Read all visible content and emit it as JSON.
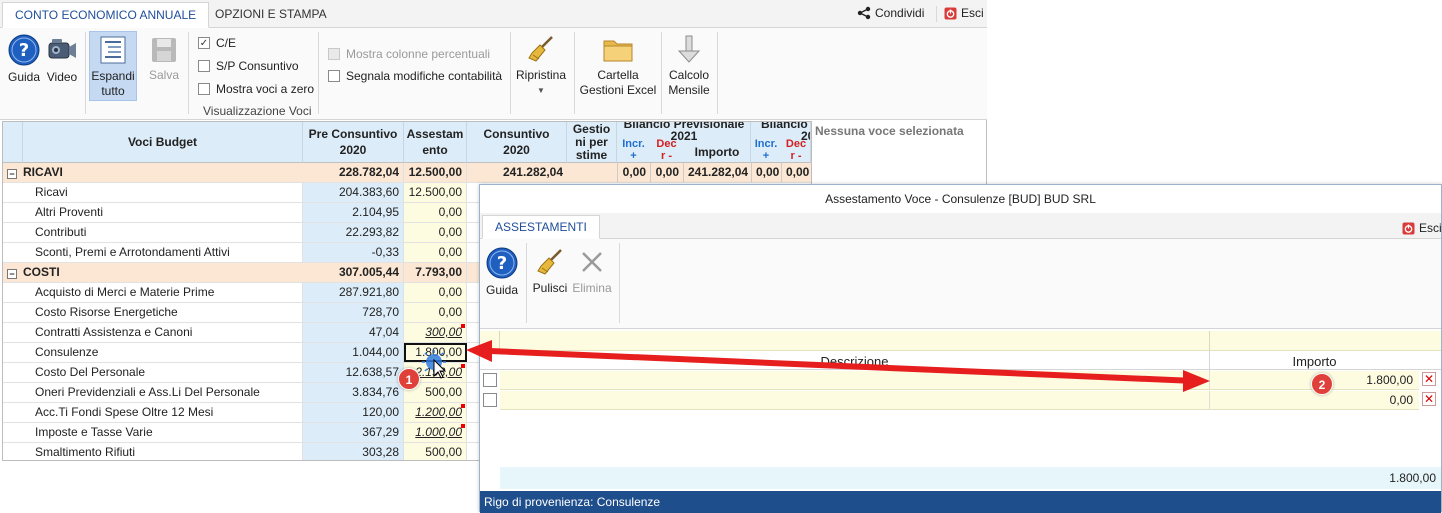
{
  "main": {
    "tabs": [
      "CONTO ECONOMICO ANNUALE",
      "OPZIONI E STAMPA"
    ],
    "share_label": "Condividi",
    "exit_label": "Esci",
    "ribbon": {
      "guida": "Guida",
      "video": "Video",
      "espandi_line1": "Espandi",
      "espandi_line2": "tutto",
      "salva": "Salva",
      "chk_ce": "C/E",
      "chk_sp": "S/P Consuntivo",
      "chk_zero": "Mostra voci a zero",
      "group_label": "Visualizzazione Voci",
      "chk_perc": "Mostra colonne percentuali",
      "chk_modif": "Segnala modifiche contabilità",
      "ripristina": "Ripristina",
      "cartella_line1": "Cartella",
      "cartella_line2": "Gestioni Excel",
      "calcolo_line1": "Calcolo",
      "calcolo_line2": "Mensile"
    },
    "grid": {
      "headers": {
        "voci": "Voci Budget",
        "pre_line1": "Pre Consuntivo",
        "pre_line2": "2020",
        "ass_line1": "Assestam",
        "ass_line2": "ento",
        "cons_line1": "Consuntivo",
        "cons_line2": "2020",
        "gest_line1": "Gestio",
        "gest_line2": "ni per",
        "gest_line3": "stime",
        "bil_prev": "Bilancio Previsionale",
        "bil_year": "2021",
        "incr": "Incr.",
        "incr2": "+",
        "decr": "Dec",
        "decr2": "r -",
        "importo": "Importo",
        "bil2": "Bilancio",
        "bil2_year": "20",
        "incr_b": "Incr.",
        "incr_b2": "+",
        "decr_b": "Dec",
        "decr_b2": "r -"
      },
      "no_selection": "Nessuna voce selezionata",
      "rows": [
        {
          "label": "RICAVI",
          "group": true,
          "pre": "228.782,04",
          "ass": "12.500,00",
          "cons": "241.282,04",
          "inc": "0,00",
          "dec": "0,00",
          "imp": "241.282,04",
          "inc2": "0,00",
          "dec2": "0,00"
        },
        {
          "label": "Ricavi",
          "pre": "204.383,60",
          "ass": "12.500,00"
        },
        {
          "label": "Altri Proventi",
          "pre": "2.104,95",
          "ass": "0,00"
        },
        {
          "label": "Contributi",
          "pre": "22.293,82",
          "ass": "0,00"
        },
        {
          "label": "Sconti, Premi e Arrotondamenti  Attivi",
          "pre": "-0,33",
          "ass": "0,00"
        },
        {
          "label": "COSTI",
          "group": true,
          "pre": "307.005,44",
          "ass": "7.793,00"
        },
        {
          "label": "Acquisto di Merci e Materie Prime",
          "pre": "287.921,80",
          "ass": "0,00"
        },
        {
          "label": "Costo Risorse Energetiche",
          "pre": "728,70",
          "ass": "0,00"
        },
        {
          "label": "Contratti Assistenza e Canoni",
          "pre": "47,04",
          "ass": "300,00",
          "modified": true
        },
        {
          "label": "Consulenze",
          "pre": "1.044,00",
          "ass": "1.800,00",
          "selected": true
        },
        {
          "label": "Costo Del Personale",
          "pre": "12.638,57",
          "ass": "2.193,00",
          "modified": true
        },
        {
          "label": "Oneri Previdenziali e Ass.Li Del Personale",
          "pre": "3.834,76",
          "ass": "500,00"
        },
        {
          "label": "Acc.Ti Fondi Spese Oltre 12 Mesi",
          "pre": "120,00",
          "ass": "1.200,00",
          "modified": true
        },
        {
          "label": "Imposte e Tasse Varie",
          "pre": "367,29",
          "ass": "1.000,00",
          "modified": true
        },
        {
          "label": "Smaltimento Rifiuti",
          "pre": "303,28",
          "ass": "500,00"
        }
      ]
    }
  },
  "dialog": {
    "title": "Assestamento Voce - Consulenze [BUD] BUD SRL",
    "tab": "ASSESTAMENTI",
    "exit_label": "Esci",
    "guida": "Guida",
    "pulisci": "Pulisci",
    "elimina": "Elimina",
    "col_descrizione": "Descrizione",
    "col_importo": "Importo",
    "rows": [
      {
        "descr": "",
        "importo": "1.800,00"
      },
      {
        "descr": "",
        "importo": "0,00"
      }
    ],
    "total": "1.800,00",
    "status": "Rigo di provenienza: Consulenze"
  },
  "badges": [
    "1",
    "2"
  ],
  "colors": {
    "accent_blue": "#1f4e9a",
    "status_bar": "#1f4e8c",
    "header_blue": "#dcecf8",
    "group_row": "#fbe7d3",
    "assest_yellow": "#fdfbe0",
    "arrow_red": "#e61e1e"
  }
}
